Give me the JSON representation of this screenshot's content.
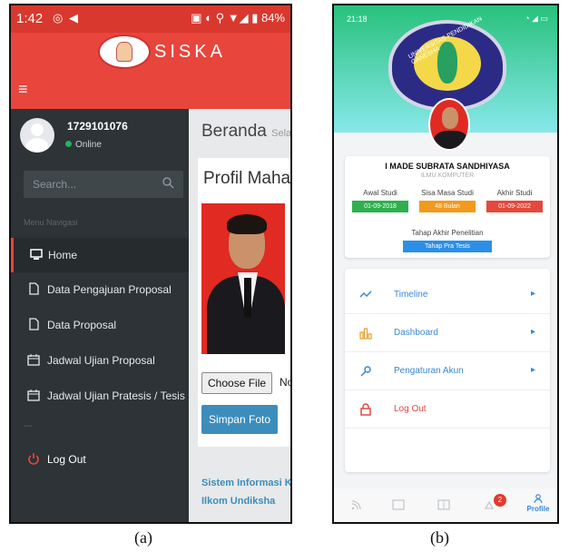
{
  "phone_a": {
    "status_bar": {
      "time": "1:42",
      "battery": "84%"
    },
    "brand": "SISKA",
    "user": {
      "id": "1729101076",
      "status": "Online"
    },
    "search": {
      "placeholder": "Search..."
    },
    "menu_header": "Menu Navigasi",
    "menu": [
      {
        "label": "Home",
        "icon": "desktop-icon",
        "active": true
      },
      {
        "label": "Data Pengajuan Proposal",
        "icon": "file-icon"
      },
      {
        "label": "Data Proposal",
        "icon": "file-icon"
      },
      {
        "label": "Jadwal Ujian Proposal",
        "icon": "calendar-icon"
      },
      {
        "label": "Jadwal Ujian Pratesis / Tesis",
        "icon": "calendar-icon"
      }
    ],
    "separator": "---",
    "logout": "Log Out",
    "content": {
      "title": "Beranda",
      "title_sub": "Sela",
      "card_title": "Profil Mahas",
      "choose_file": "Choose File",
      "no_file": "No",
      "save_button": "Simpan Foto",
      "footer_line1": "Sistem Informasi K",
      "footer_line2": "Ilkom Undiksha"
    }
  },
  "phone_b": {
    "status_bar": {
      "time": "21:18"
    },
    "seal_text": "UNIVERSITAS PENDIDIKAN GANESHA",
    "student_name": "I MADE SUBRATA SANDHIYASA",
    "program": "ILMU KOMPUTER",
    "stats": [
      {
        "label": "Awal Studi",
        "value": "01-09-2018",
        "color": "#2fb04f"
      },
      {
        "label": "Sisa Masa Studi",
        "value": "48 Bulan",
        "color": "#f29a1c"
      },
      {
        "label": "Akhir Studi",
        "value": "01-09-2022",
        "color": "#e5483c"
      }
    ],
    "stage": {
      "label": "Tahap Akhir Penelitian",
      "value": "Tahap Pra Tesis"
    },
    "menu": [
      {
        "label": "Timeline",
        "icon": "timeline-icon"
      },
      {
        "label": "Dashboard",
        "icon": "bar-chart-icon"
      },
      {
        "label": "Pengaturan Akun",
        "icon": "key-icon"
      },
      {
        "label": "Log Out",
        "icon": "lock-icon"
      }
    ],
    "bottom_nav": {
      "badge": "2",
      "profile_label": "Profile"
    }
  },
  "captions": {
    "a": "(a)",
    "b": "(b)"
  }
}
